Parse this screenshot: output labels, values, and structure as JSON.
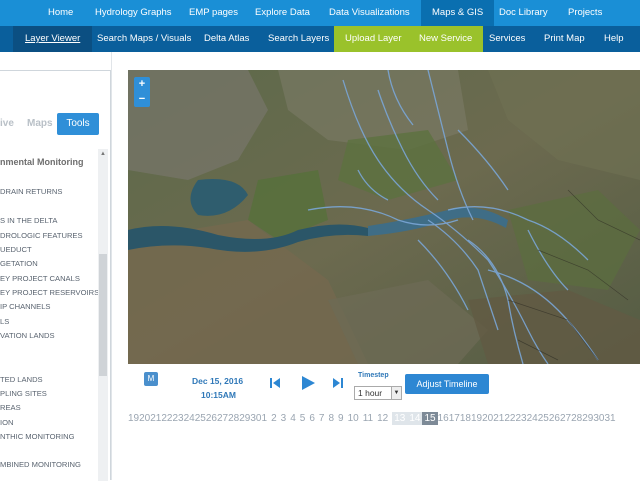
{
  "topnav": {
    "items": [
      {
        "label": "Home"
      },
      {
        "label": "Hydrology Graphs"
      },
      {
        "label": "EMP pages"
      },
      {
        "label": "Explore Data"
      },
      {
        "label": "Data Visualizations"
      },
      {
        "label": "Maps & GIS",
        "active": true
      },
      {
        "label": "Doc Library"
      },
      {
        "label": "Projects"
      }
    ]
  },
  "subnav": {
    "items": [
      {
        "label": "Layer Viewer",
        "active": true
      },
      {
        "label": "Search Maps / Visuals"
      },
      {
        "label": "Delta Atlas"
      },
      {
        "label": "Search Layers"
      },
      {
        "label": "Upload Layer",
        "highlight": "green"
      },
      {
        "label": "New Service",
        "highlight": "green"
      },
      {
        "label": "Services"
      },
      {
        "label": "Print Map"
      },
      {
        "label": "Help"
      }
    ]
  },
  "sidebar": {
    "tabs": [
      {
        "label": "ive"
      },
      {
        "label": "Maps"
      },
      {
        "label": "Tools",
        "active": true
      }
    ],
    "heading": "nmental Monitoring",
    "items": [
      "DRAIN RETURNS",
      "S IN THE DELTA",
      "DROLOGIC FEATURES",
      "UEDUCT",
      "GETATION",
      "EY PROJECT CANALS",
      "EY PROJECT RESERVOIRS",
      "IP CHANNELS",
      "LS",
      "VATION LANDS",
      "TED LANDS",
      "PLING SITES",
      "REAS",
      "ION",
      "NTHIC MONITORING",
      "MBINED MONITORING"
    ]
  },
  "map": {
    "zoom_in": "+",
    "zoom_out": "−"
  },
  "timeline": {
    "m_label": "M",
    "date": "Dec 15, 2016",
    "time": "10:15AM",
    "timestep_label": "Timestep",
    "timestep_value": "1 hour",
    "adjust_label": "Adjust Timeline",
    "days": [
      "19",
      "20",
      "21",
      "22",
      "23",
      "24",
      "25",
      "26",
      "27",
      "28",
      "29",
      "30",
      "1",
      "2",
      "3",
      "4",
      "5",
      "6",
      "7",
      "8",
      "9",
      "10",
      "11",
      "12",
      "13",
      "14",
      "15",
      "16",
      "17",
      "18",
      "19",
      "20",
      "21",
      "22",
      "23",
      "24",
      "25",
      "26",
      "27",
      "28",
      "29",
      "30",
      "31"
    ],
    "selected_light_index": 24,
    "selected_dark_index": 26
  },
  "colors": {
    "topnav_bg": "#1a8fd6",
    "subnav_bg": "#0a5f9c",
    "green": "#9ac22b",
    "accent": "#2d87d3"
  }
}
